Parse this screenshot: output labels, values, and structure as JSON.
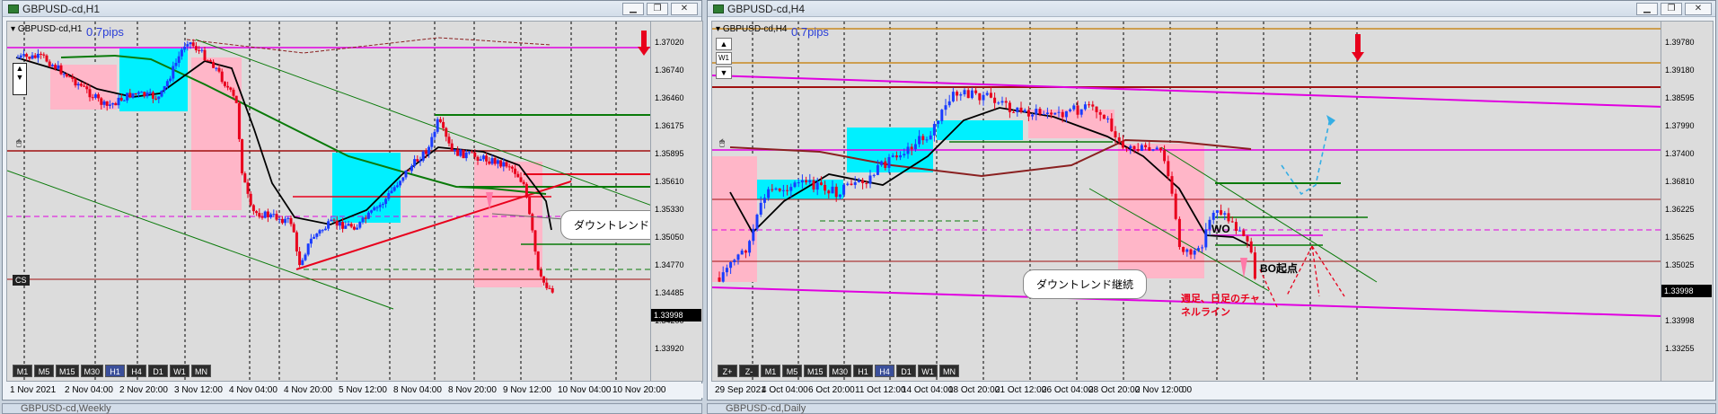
{
  "left": {
    "title": "GBPUSD-cd,H1",
    "symbol": "GBPUSD-cd,H1",
    "pips": "0.7pips",
    "cs": "CS",
    "callout": "ダウントレンドに転換",
    "yticks": [
      "1.37020",
      "1.36740",
      "1.36460",
      "1.36175",
      "1.35895",
      "1.35610",
      "1.35330",
      "1.35050",
      "1.34770",
      "1.34485",
      "1.34200",
      "1.33920"
    ],
    "ycurrent": "1.33998",
    "xticks": [
      "1 Nov 2021",
      "2 Nov 04:00",
      "2 Nov 20:00",
      "3 Nov 12:00",
      "4 Nov 04:00",
      "4 Nov 20:00",
      "5 Nov 12:00",
      "8 Nov 04:00",
      "8 Nov 20:00",
      "9 Nov 12:00",
      "10 Nov 04:00",
      "10 Nov 20:00"
    ],
    "timeframes": [
      "M1",
      "M5",
      "M15",
      "M30",
      "H1",
      "H4",
      "D1",
      "W1",
      "MN"
    ],
    "active_tf": "H1"
  },
  "right": {
    "title": "GBPUSD-cd,H4",
    "symbol": "GBPUSD-cd,H4",
    "pips": "0.7pips",
    "side_w1": "W1",
    "wo_label": "WO",
    "bo_label": "BO起点",
    "callout": "ダウントレンド継続",
    "red_note_1": "週足、日足のチャ",
    "red_note_2": "ネルライン",
    "yticks": [
      "1.39780",
      "1.39180",
      "1.38595",
      "1.37990",
      "1.37400",
      "1.36810",
      "1.36225",
      "1.35625",
      "1.35025",
      "1.34440",
      "1.33998",
      "1.33255"
    ],
    "ycurrent": "1.33998",
    "xticks": [
      "29 Sep 2021",
      "4 Oct 04:00",
      "6 Oct 20:00",
      "11 Oct 12:00",
      "14 Oct 04:00",
      "18 Oct 20:00",
      "21 Oct 12:00",
      "26 Oct 04:00",
      "28 Oct 20:00",
      "2 Nov 12:00",
      "00"
    ],
    "timeframes": [
      "Z+",
      "Z-",
      "M1",
      "M5",
      "M15",
      "M30",
      "H1",
      "H4",
      "D1",
      "W1",
      "MN"
    ],
    "active_tf": "H4"
  },
  "bottom": {
    "left_title": "GBPUSD-cd,Weekly",
    "right_title": "GBPUSD-cd,Daily"
  },
  "colors": {
    "chart_bg": "#dcdcdc",
    "bull": "#1a3cff",
    "bear": "#e8001c",
    "cyan_zone": "#00f0ff",
    "pink_zone": "#ffb6c8",
    "magenta": "#e000e0",
    "dark_red": "#a01010",
    "green": "#0a7a0a"
  }
}
